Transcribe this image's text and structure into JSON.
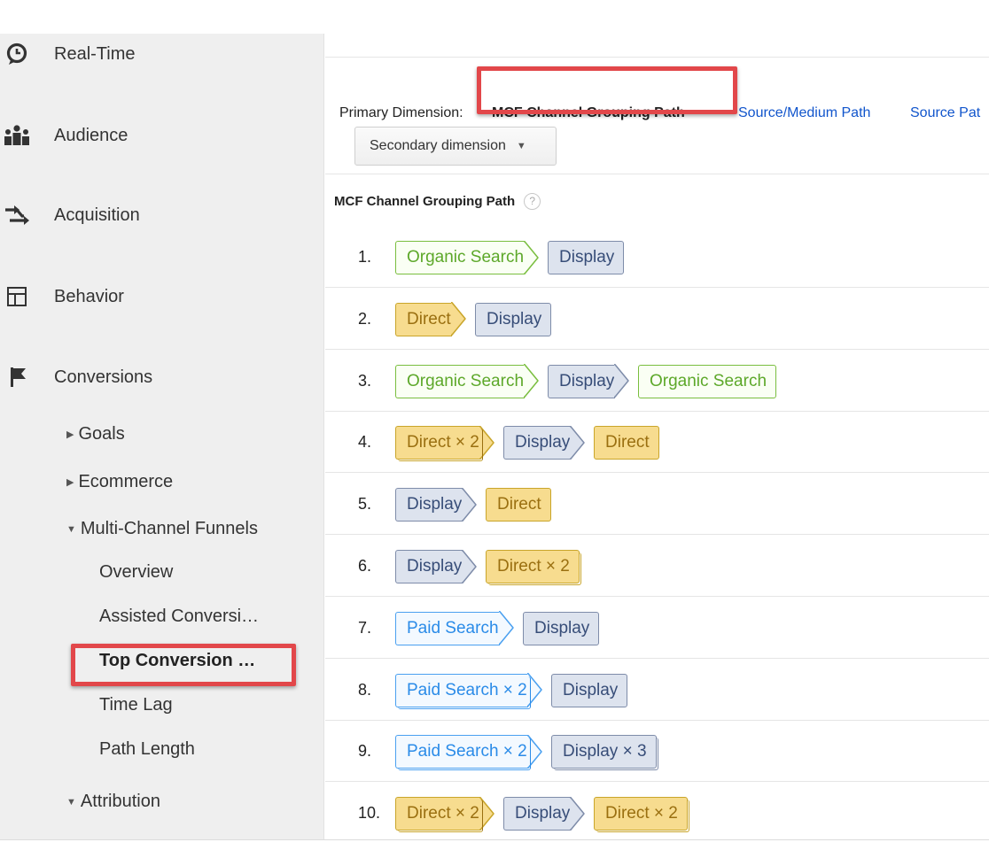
{
  "sidebar": {
    "sections": [
      {
        "label": "Real-Time",
        "icon": "clock-icon"
      },
      {
        "label": "Audience",
        "icon": "people-icon"
      },
      {
        "label": "Acquisition",
        "icon": "acquisition-arrows-icon"
      },
      {
        "label": "Behavior",
        "icon": "behavior-layout-icon"
      },
      {
        "label": "Conversions",
        "icon": "flag-icon"
      }
    ],
    "conversions_children": {
      "goals": "Goals",
      "ecommerce": "Ecommerce",
      "mcf": "Multi-Channel Funnels",
      "mcf_items": [
        "Overview",
        "Assisted Conversi…",
        "Top Conversion …",
        "Time Lag",
        "Path Length"
      ],
      "attribution": "Attribution"
    }
  },
  "main": {
    "primary_dimension_label": "Primary Dimension:",
    "active_dimension": "MCF Channel Grouping Path",
    "dimension_links": [
      "Source/Medium Path",
      "Source Pat"
    ],
    "secondary_dimension": "Secondary dimension",
    "column_header": "MCF Channel Grouping Path",
    "help": "?"
  },
  "colors": {
    "Organic Search": "#5da82a",
    "Display": "#374d78",
    "Direct": "#9a6f10",
    "Paid Search": "#2a8be8",
    "highlight": "#e2474a",
    "link": "#1155cc"
  },
  "paths": [
    {
      "num": "1.",
      "steps": [
        {
          "channel": "Organic Search",
          "count": 1
        },
        {
          "channel": "Display",
          "count": 1
        }
      ]
    },
    {
      "num": "2.",
      "steps": [
        {
          "channel": "Direct",
          "count": 1
        },
        {
          "channel": "Display",
          "count": 1
        }
      ]
    },
    {
      "num": "3.",
      "steps": [
        {
          "channel": "Organic Search",
          "count": 1
        },
        {
          "channel": "Display",
          "count": 1
        },
        {
          "channel": "Organic Search",
          "count": 1
        }
      ]
    },
    {
      "num": "4.",
      "steps": [
        {
          "channel": "Direct",
          "count": 2
        },
        {
          "channel": "Display",
          "count": 1
        },
        {
          "channel": "Direct",
          "count": 1
        }
      ]
    },
    {
      "num": "5.",
      "steps": [
        {
          "channel": "Display",
          "count": 1
        },
        {
          "channel": "Direct",
          "count": 1
        }
      ]
    },
    {
      "num": "6.",
      "steps": [
        {
          "channel": "Display",
          "count": 1
        },
        {
          "channel": "Direct",
          "count": 2
        }
      ]
    },
    {
      "num": "7.",
      "steps": [
        {
          "channel": "Paid Search",
          "count": 1
        },
        {
          "channel": "Display",
          "count": 1
        }
      ]
    },
    {
      "num": "8.",
      "steps": [
        {
          "channel": "Paid Search",
          "count": 2
        },
        {
          "channel": "Display",
          "count": 1
        }
      ]
    },
    {
      "num": "9.",
      "steps": [
        {
          "channel": "Paid Search",
          "count": 2
        },
        {
          "channel": "Display",
          "count": 3
        }
      ]
    },
    {
      "num": "10.",
      "steps": [
        {
          "channel": "Direct",
          "count": 2
        },
        {
          "channel": "Display",
          "count": 1
        },
        {
          "channel": "Direct",
          "count": 2
        }
      ]
    }
  ]
}
